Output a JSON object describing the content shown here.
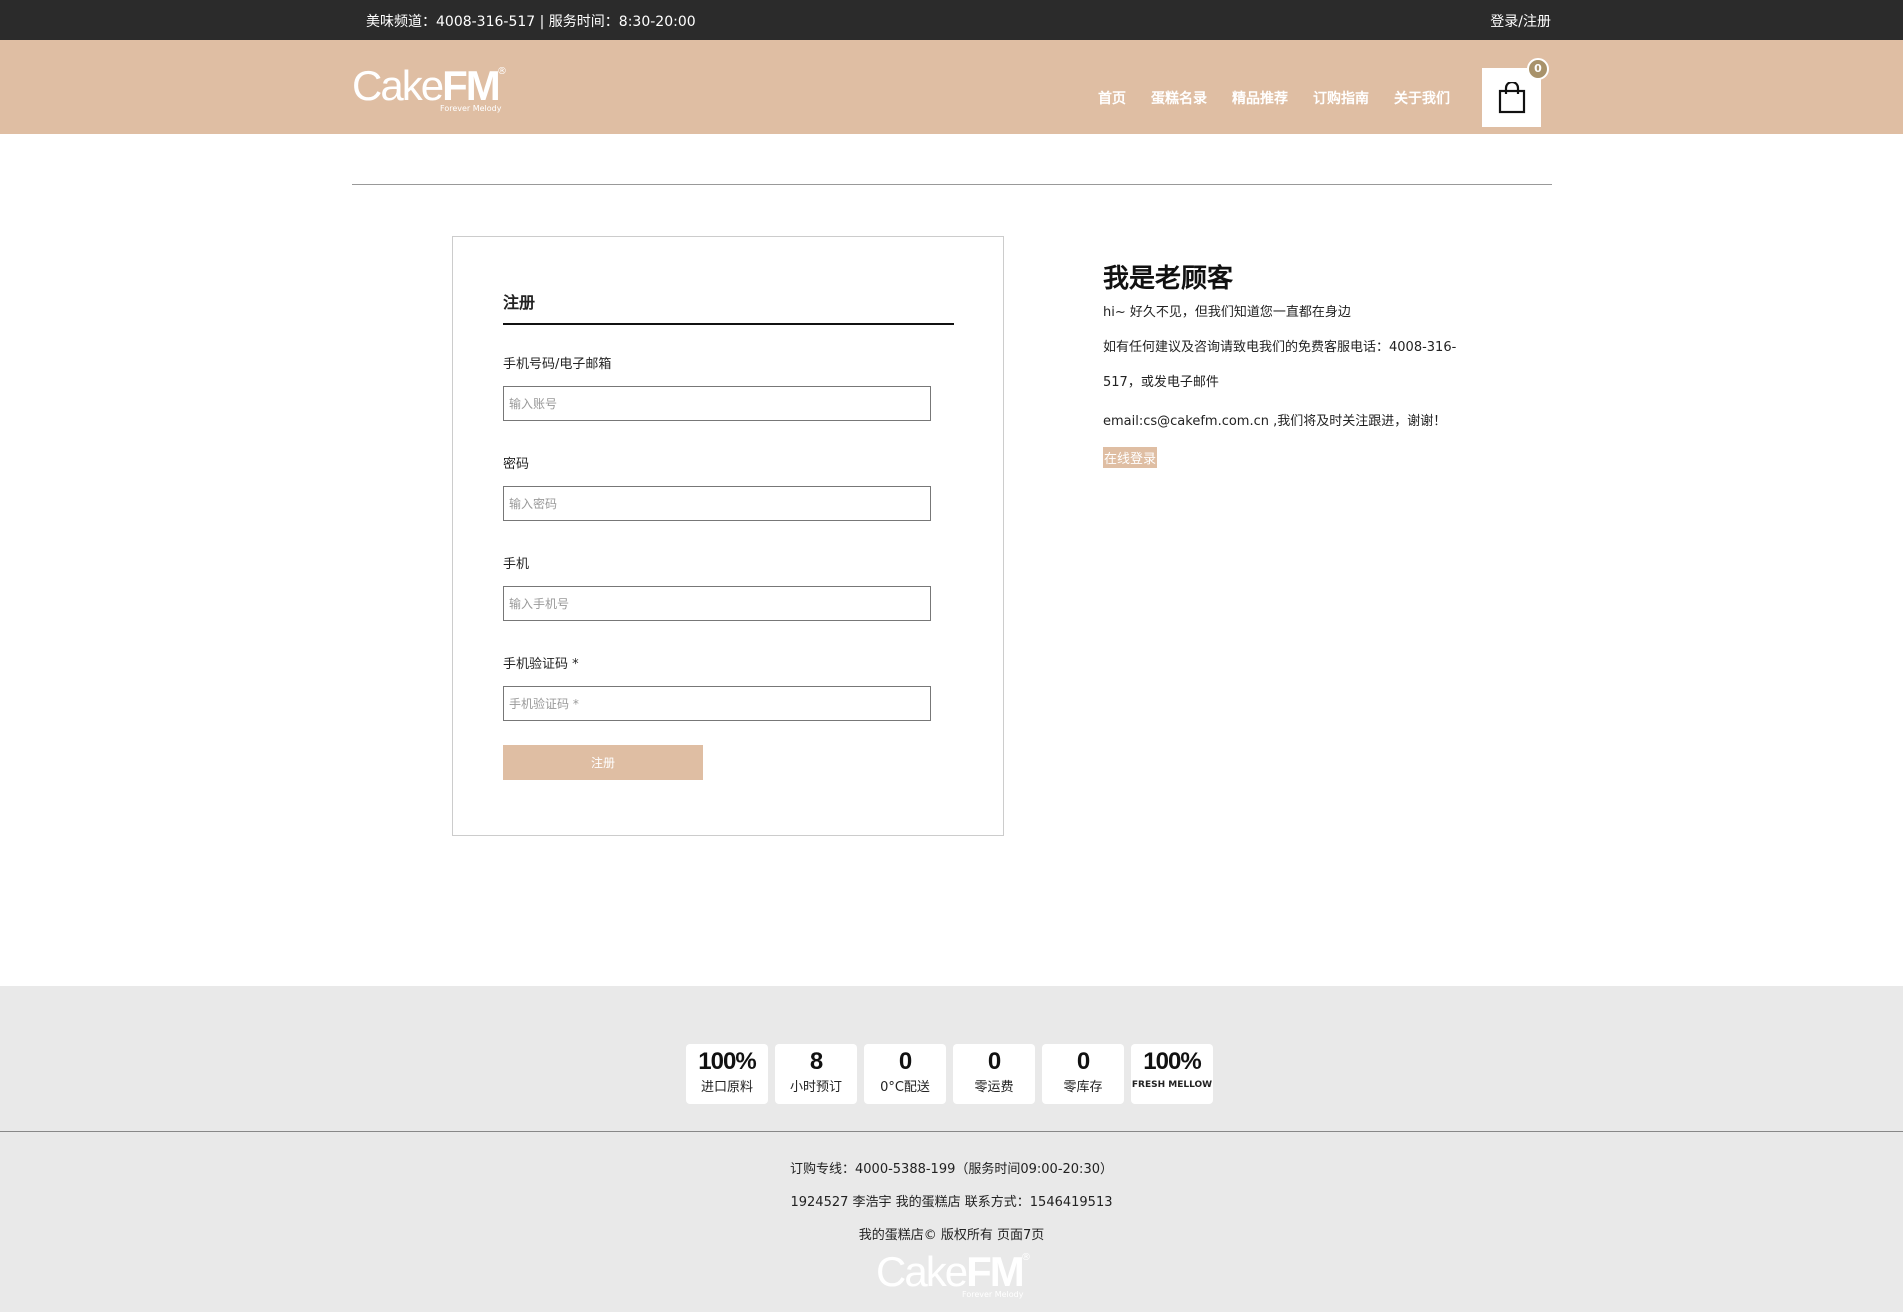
{
  "topbar": {
    "hotline": "美味频道：4008-316-517 | 服务时间：8:30-20:00",
    "login": "登录/注册"
  },
  "header": {
    "logo": {
      "word_light": "Cake",
      "word_bold": "FM",
      "reg": "®",
      "tagline": "Forever Melody"
    },
    "nav": [
      "首页",
      "蛋糕名录",
      "精品推荐",
      "订购指南",
      "关于我们"
    ],
    "cart_count": "0"
  },
  "form": {
    "title": "注册",
    "fields": [
      {
        "label": "手机号码/电子邮箱",
        "placeholder": "输入账号"
      },
      {
        "label": "密码",
        "placeholder": "输入密码"
      },
      {
        "label": "手机",
        "placeholder": "输入手机号"
      },
      {
        "label": "手机验证码 *",
        "placeholder": "手机验证码 *"
      }
    ],
    "submit": "注册"
  },
  "side": {
    "title": "我是老顾客",
    "greeting": "hi~ 好久不见，但我们知道您一直都在身边",
    "contact": "如有任何建议及咨询请致电我们的免费客服电话：4008-316-517，或发电子邮件",
    "email": "email:cs@cakefm.com.cn ,我们将及时关注跟进，谢谢！",
    "login_link": "在线登录"
  },
  "footer": {
    "badges": [
      {
        "num": "100%",
        "label": "进口原料"
      },
      {
        "num": "8",
        "label": "小时预订"
      },
      {
        "num": "0",
        "label": "0°C配送"
      },
      {
        "num": "0",
        "label": "零运费"
      },
      {
        "num": "0",
        "label": "零库存"
      },
      {
        "num": "100%",
        "label": "FRESH MELLOW"
      }
    ],
    "hotline": "订购专线：4000-5388-199（服务时间09:00-20:30）",
    "info": "1924527 李浩宇 我的蛋糕店 联系方式：1546419513",
    "copyright": "我的蛋糕店© 版权所有 页面7页"
  },
  "colors": {
    "accent": "#dfbea3",
    "topbar": "#2b2b2b",
    "footer_bg": "#e9e9e9",
    "badge": "#a8926a"
  },
  "icons": {
    "cart": "shopping-bag-icon"
  }
}
